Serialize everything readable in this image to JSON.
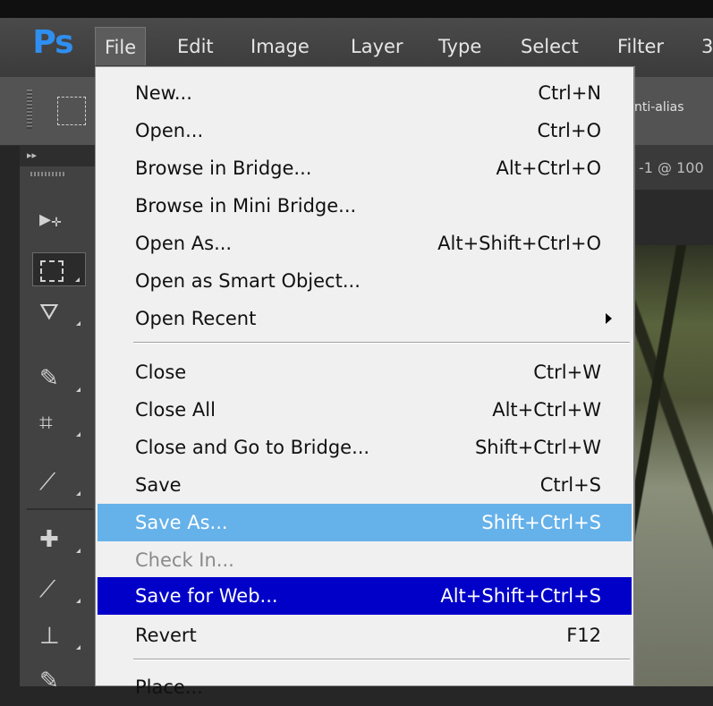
{
  "app": {
    "logo": "Ps"
  },
  "menubar": {
    "items": [
      "File",
      "Edit",
      "Image",
      "Layer",
      "Type",
      "Select",
      "Filter",
      "3"
    ]
  },
  "options_bar": {
    "antialias_label": "nti-alias"
  },
  "document": {
    "tab_label": "-1 @ 100"
  },
  "tools": [
    {
      "name": "move-tool",
      "icon": "move-icon"
    },
    {
      "name": "marquee-tool",
      "icon": "rect-marquee-icon"
    },
    {
      "name": "lasso-tool",
      "icon": "polygonal-lasso-icon"
    },
    {
      "name": "quick-selection-tool",
      "icon": "quick-selection-icon"
    },
    {
      "name": "crop-tool",
      "icon": "crop-icon"
    },
    {
      "name": "eyedropper-tool",
      "icon": "eyedropper-icon"
    },
    {
      "name": "healing-brush-tool",
      "icon": "bandage-icon"
    },
    {
      "name": "brush-tool",
      "icon": "brush-icon"
    },
    {
      "name": "clone-stamp-tool",
      "icon": "stamp-icon"
    }
  ],
  "file_menu": {
    "items": [
      {
        "label": "New...",
        "shortcut": "Ctrl+N"
      },
      {
        "label": "Open...",
        "shortcut": "Ctrl+O"
      },
      {
        "label": "Browse in Bridge...",
        "shortcut": "Alt+Ctrl+O"
      },
      {
        "label": "Browse in Mini Bridge...",
        "shortcut": ""
      },
      {
        "label": "Open As...",
        "shortcut": "Alt+Shift+Ctrl+O"
      },
      {
        "label": "Open as Smart Object...",
        "shortcut": ""
      },
      {
        "label": "Open Recent",
        "shortcut": "",
        "submenu": true
      },
      {
        "label": "Close",
        "shortcut": "Ctrl+W"
      },
      {
        "label": "Close All",
        "shortcut": "Alt+Ctrl+W"
      },
      {
        "label": "Close and Go to Bridge...",
        "shortcut": "Shift+Ctrl+W"
      },
      {
        "label": "Save",
        "shortcut": "Ctrl+S"
      },
      {
        "label": "Save As...",
        "shortcut": "Shift+Ctrl+S",
        "state": "hover"
      },
      {
        "label": "Check In...",
        "shortcut": "",
        "state": "disabled"
      },
      {
        "label": "Save for Web...",
        "shortcut": "Alt+Shift+Ctrl+S",
        "state": "selected"
      },
      {
        "label": "Revert",
        "shortcut": "F12"
      },
      {
        "label": "Place...",
        "shortcut": ""
      }
    ]
  },
  "colors": {
    "hover": "#65b1ea",
    "selected": "#0000c8",
    "menu_bg": "#f0f0f0",
    "logo": "#2f8ff0"
  }
}
